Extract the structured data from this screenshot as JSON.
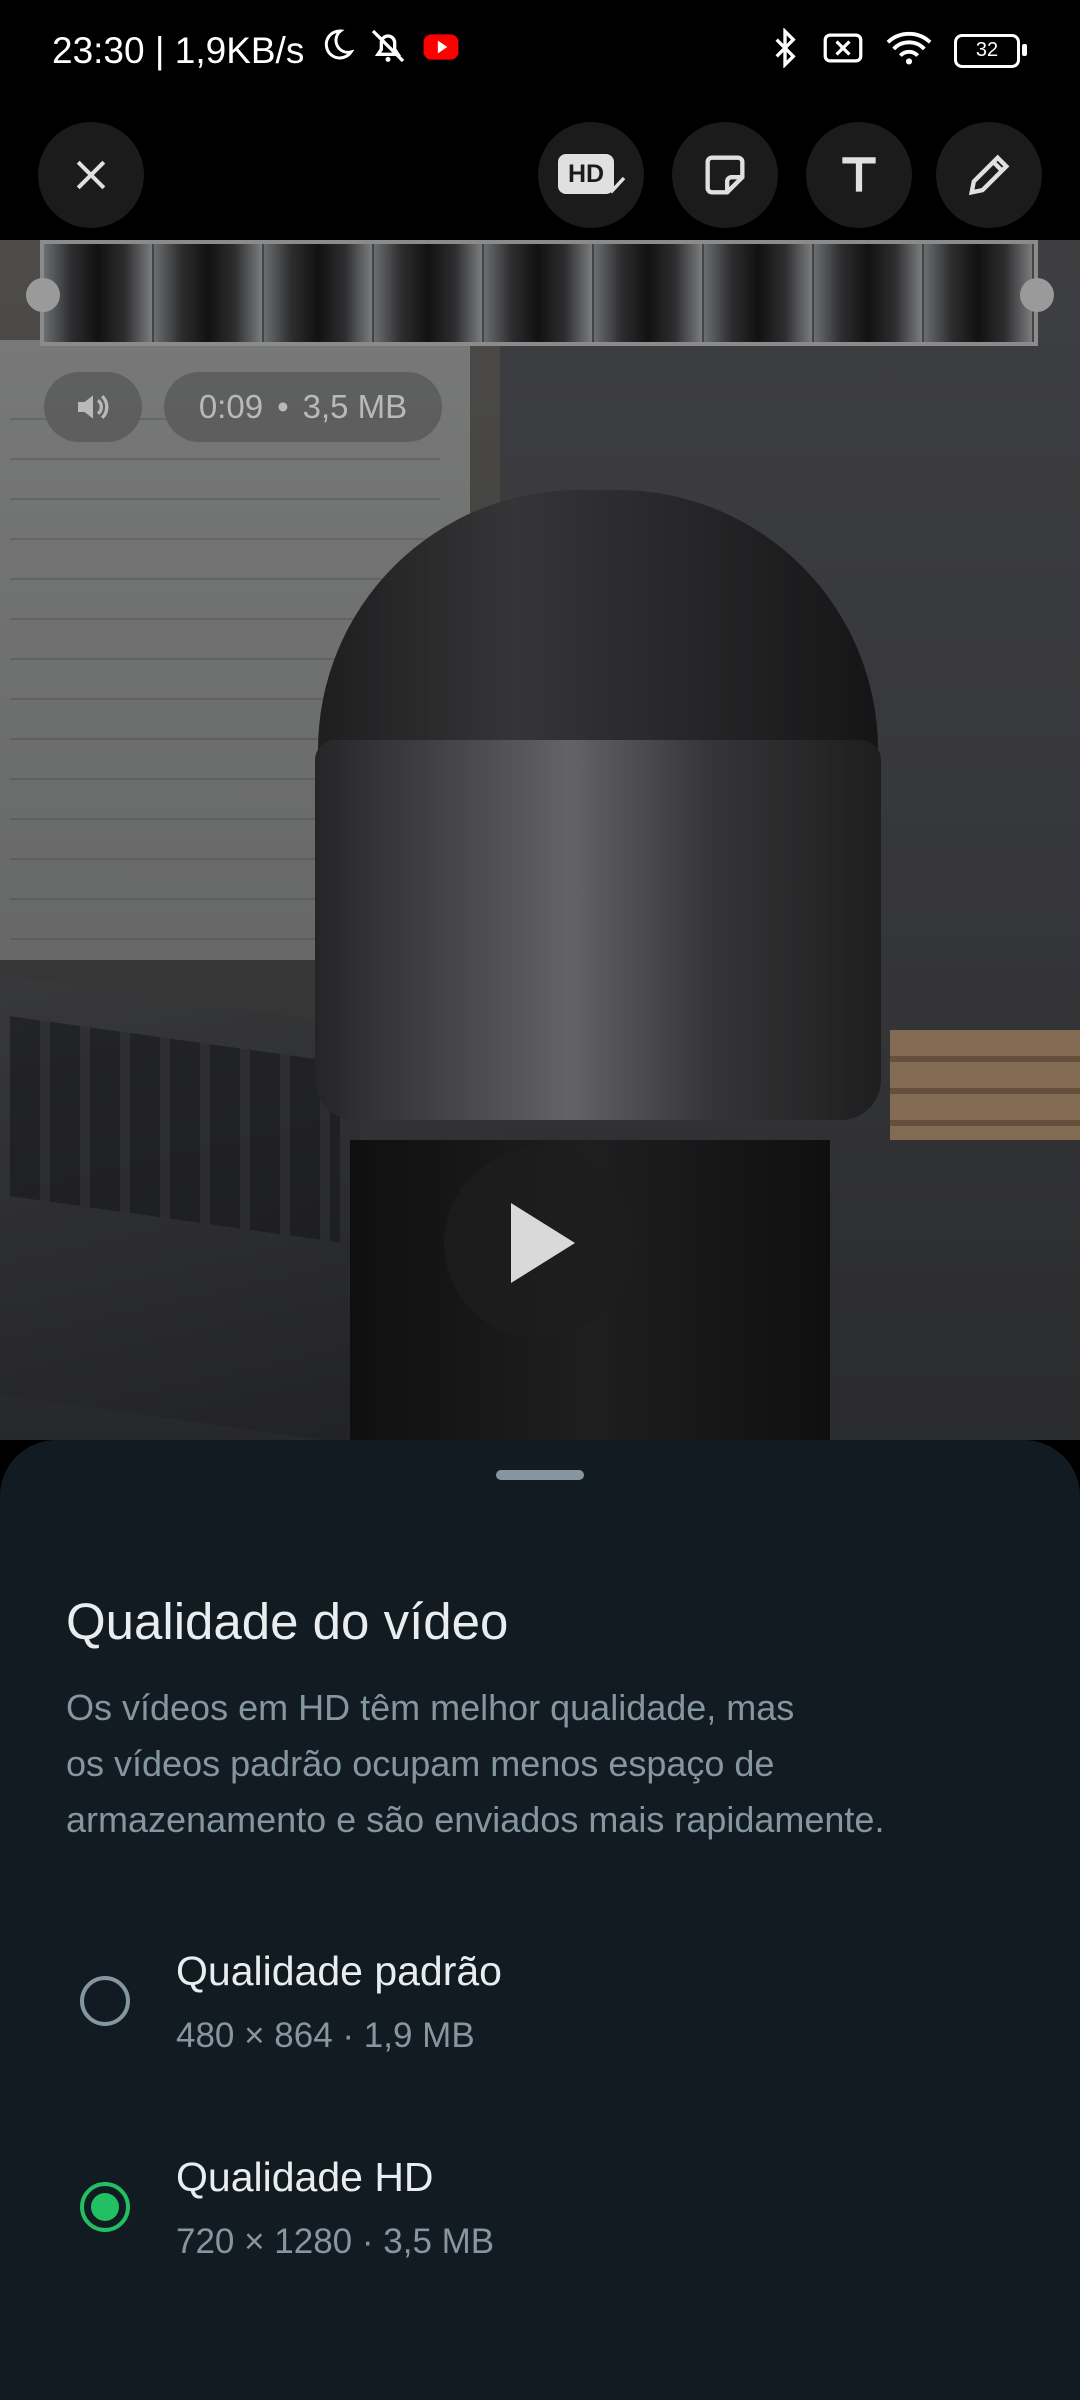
{
  "status_bar": {
    "time_and_speed": "23:30 | 1,9KB/s",
    "battery": "32",
    "icons": [
      "moon-icon",
      "muted-bell-icon",
      "youtube-icon",
      "bluetooth-icon",
      "no-sim-icon",
      "wifi-icon",
      "battery-icon"
    ]
  },
  "toolbar": {
    "hd_badge": "HD",
    "icons": [
      "close-icon",
      "hd-quality-icon",
      "sticker-icon",
      "text-icon",
      "pencil-icon"
    ]
  },
  "video": {
    "duration": "0:09",
    "separator": "•",
    "size": "3,5 MB"
  },
  "sheet": {
    "title": "Qualidade do vídeo",
    "description": "Os vídeos em HD têm melhor qualidade, mas\nos vídeos padrão ocupam menos espaço de\narmazenamento e são enviados mais rapidamente.",
    "options": [
      {
        "label": "Qualidade padrão",
        "meta": "480 × 864 · 1,9 MB",
        "selected": false
      },
      {
        "label": "Qualidade HD",
        "meta": "720 × 1280 · 3,5 MB",
        "selected": true
      }
    ],
    "accent_color": "#21c063"
  }
}
